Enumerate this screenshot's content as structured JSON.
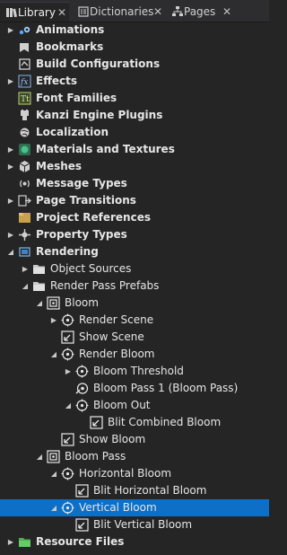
{
  "tabs": [
    {
      "label": "Library",
      "icon": "library-icon",
      "active": true,
      "close": "✕"
    },
    {
      "label": "Dictionaries",
      "icon": "dictionaries-icon",
      "active": false,
      "close": "✕"
    },
    {
      "label": "Pages",
      "icon": "pages-icon",
      "active": false,
      "close": "✕"
    }
  ],
  "tree": [
    {
      "label": "Animations",
      "icon": "animations-icon",
      "level": 0,
      "arrow": "collapsed"
    },
    {
      "label": "Bookmarks",
      "icon": "bookmarks-icon",
      "level": 0,
      "arrow": "none"
    },
    {
      "label": "Build Configurations",
      "icon": "build-configurations-icon",
      "level": 0,
      "arrow": "none"
    },
    {
      "label": "Effects",
      "icon": "effects-icon",
      "level": 0,
      "arrow": "collapsed"
    },
    {
      "label": "Font Families",
      "icon": "font-families-icon",
      "level": 0,
      "arrow": "none"
    },
    {
      "label": "Kanzi Engine Plugins",
      "icon": "plugins-icon",
      "level": 0,
      "arrow": "none"
    },
    {
      "label": "Localization",
      "icon": "localization-icon",
      "level": 0,
      "arrow": "none"
    },
    {
      "label": "Materials and Textures",
      "icon": "materials-icon",
      "level": 0,
      "arrow": "collapsed"
    },
    {
      "label": "Meshes",
      "icon": "meshes-icon",
      "level": 0,
      "arrow": "collapsed"
    },
    {
      "label": "Message Types",
      "icon": "message-types-icon",
      "level": 0,
      "arrow": "none"
    },
    {
      "label": "Page Transitions",
      "icon": "page-transitions-icon",
      "level": 0,
      "arrow": "collapsed"
    },
    {
      "label": "Project References",
      "icon": "project-references-icon",
      "level": 0,
      "arrow": "none"
    },
    {
      "label": "Property Types",
      "icon": "property-types-icon",
      "level": 0,
      "arrow": "collapsed"
    },
    {
      "label": "Rendering",
      "icon": "rendering-icon",
      "level": 0,
      "arrow": "expanded"
    },
    {
      "label": "Object Sources",
      "icon": "folder-icon",
      "level": 1,
      "arrow": "collapsed"
    },
    {
      "label": "Render Pass Prefabs",
      "icon": "folder-icon",
      "level": 1,
      "arrow": "expanded"
    },
    {
      "label": "Bloom",
      "icon": "render-pass-prefab-icon",
      "level": 2,
      "arrow": "expanded"
    },
    {
      "label": "Render Scene",
      "icon": "render-pass-icon",
      "level": 3,
      "arrow": "collapsed"
    },
    {
      "label": "Show Scene",
      "icon": "blit-pass-icon",
      "level": 3,
      "arrow": "none"
    },
    {
      "label": "Render Bloom",
      "icon": "render-pass-icon",
      "level": 3,
      "arrow": "expanded"
    },
    {
      "label": "Bloom Threshold",
      "icon": "render-pass-icon",
      "level": 4,
      "arrow": "collapsed"
    },
    {
      "label": "Bloom Pass 1 (Bloom Pass)",
      "icon": "linked-render-pass-icon",
      "level": 4,
      "arrow": "none"
    },
    {
      "label": "Bloom Out",
      "icon": "render-pass-icon",
      "level": 4,
      "arrow": "expanded"
    },
    {
      "label": "Blit Combined Bloom",
      "icon": "blit-pass-icon",
      "level": 5,
      "arrow": "none"
    },
    {
      "label": "Show Bloom",
      "icon": "blit-pass-icon",
      "level": 3,
      "arrow": "none"
    },
    {
      "label": "Bloom Pass",
      "icon": "render-pass-prefab-icon",
      "level": 2,
      "arrow": "expanded"
    },
    {
      "label": "Horizontal Bloom",
      "icon": "render-pass-icon",
      "level": 3,
      "arrow": "expanded"
    },
    {
      "label": "Blit Horizontal Bloom",
      "icon": "blit-pass-icon",
      "level": 4,
      "arrow": "none"
    },
    {
      "label": "Vertical Bloom",
      "icon": "render-pass-icon",
      "level": 3,
      "arrow": "expanded",
      "selected": true
    },
    {
      "label": "Blit Vertical Bloom",
      "icon": "blit-pass-icon",
      "level": 4,
      "arrow": "none"
    },
    {
      "label": "Resource Files",
      "icon": "resource-files-icon",
      "level": 0,
      "arrow": "collapsed"
    }
  ],
  "colors": {
    "background": "#252526",
    "tabbar": "#2d2d30",
    "selection": "#0e6fc7",
    "text": "#e6e6e6"
  }
}
